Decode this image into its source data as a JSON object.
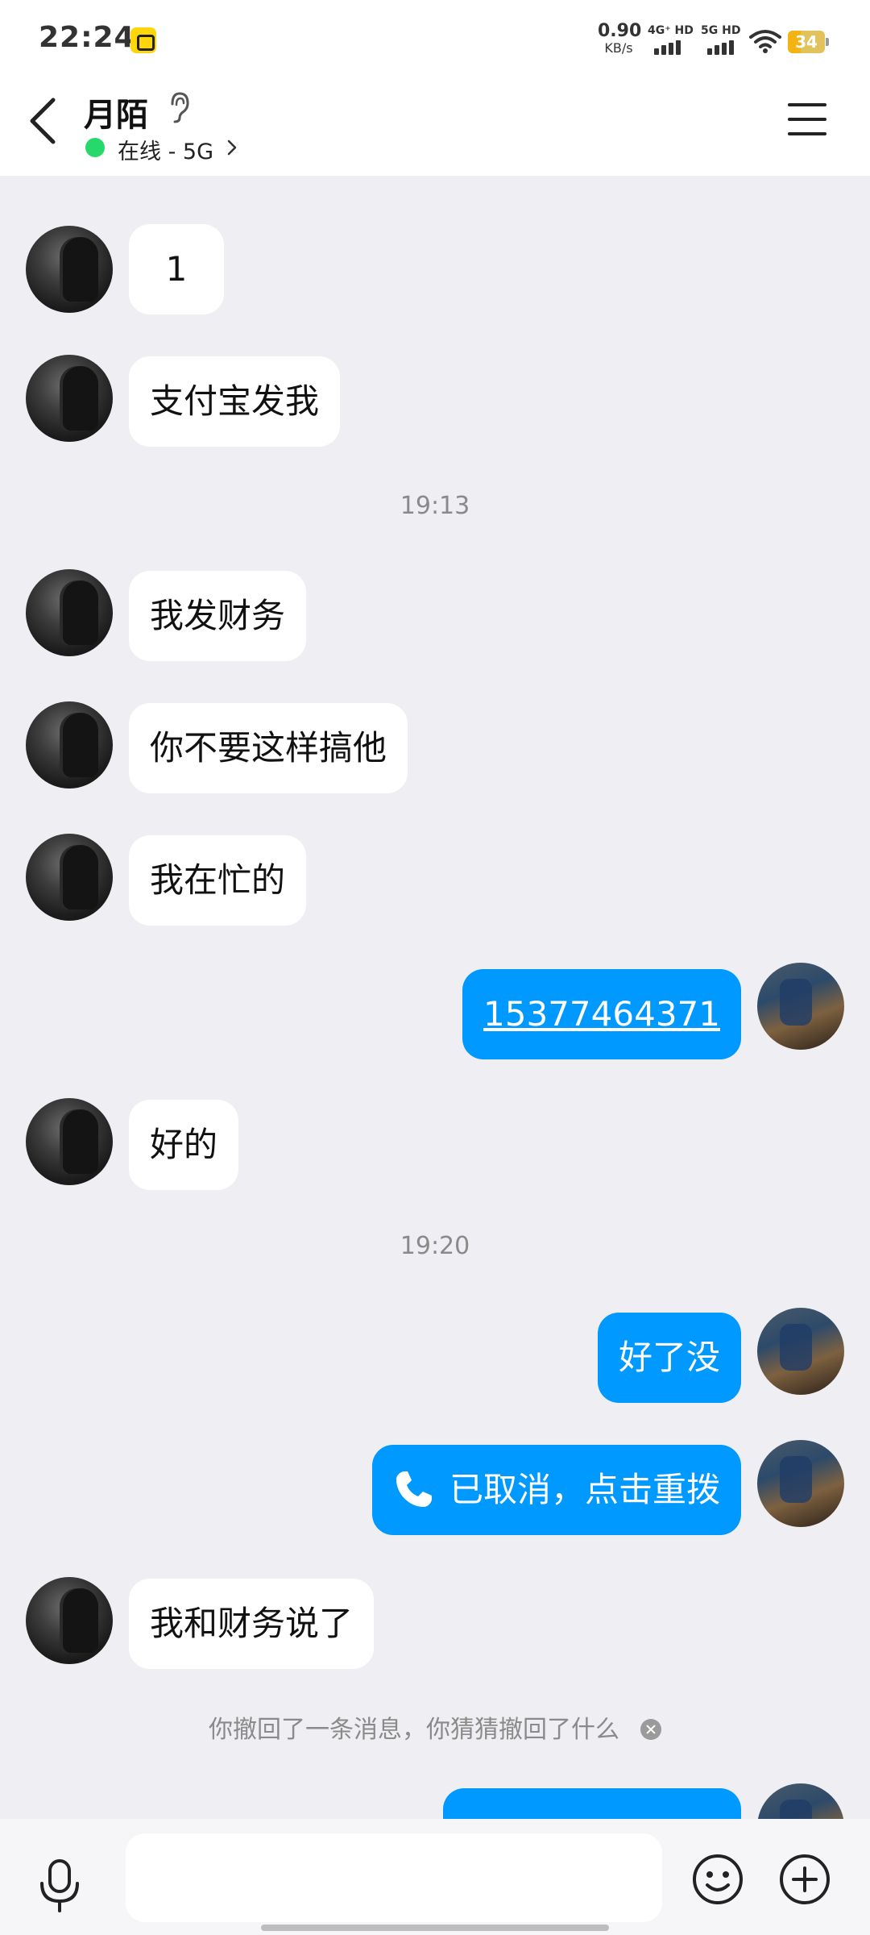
{
  "status_bar": {
    "time": "22:24",
    "net_speed_value": "0.90",
    "net_speed_unit": "KB/s",
    "sim1_label": "4G⁺ HD",
    "sim2_label": "5G HD",
    "battery": "34",
    "battery_level": 0.34,
    "battery_color": "#f3b413"
  },
  "header": {
    "contact_name": "月陌",
    "status_text": "在线 - 5G",
    "status_color": "#27d96b",
    "icons": [
      "back-arrow-icon",
      "ear-icon",
      "chevron-right-icon",
      "menu-icon"
    ]
  },
  "messages": [
    {
      "type": "in",
      "text": "1"
    },
    {
      "type": "in",
      "text": "支付宝发我"
    },
    {
      "type": "time",
      "text": "19:13"
    },
    {
      "type": "in",
      "text": "我发财务"
    },
    {
      "type": "in",
      "text": "你不要这样搞他"
    },
    {
      "type": "in",
      "text": "我在忙的"
    },
    {
      "type": "out",
      "text": "15377464371",
      "link": true
    },
    {
      "type": "in",
      "text": "好的"
    },
    {
      "type": "time",
      "text": "19:20"
    },
    {
      "type": "out",
      "text": "好了没"
    },
    {
      "type": "out",
      "text": "已取消，点击重拨",
      "icon": "phone-icon"
    },
    {
      "type": "in",
      "text": "我和财务说了"
    },
    {
      "type": "notice",
      "text": "你撤回了一条消息，你猜猜撤回了什么"
    }
  ],
  "input_bar": {
    "placeholder": "",
    "icons": [
      "microphone-icon",
      "emoji-icon",
      "plus-icon"
    ]
  },
  "colors": {
    "outgoing_bubble": "#0099ff",
    "incoming_bubble": "#ffffff",
    "chat_background": "#efeff3"
  }
}
